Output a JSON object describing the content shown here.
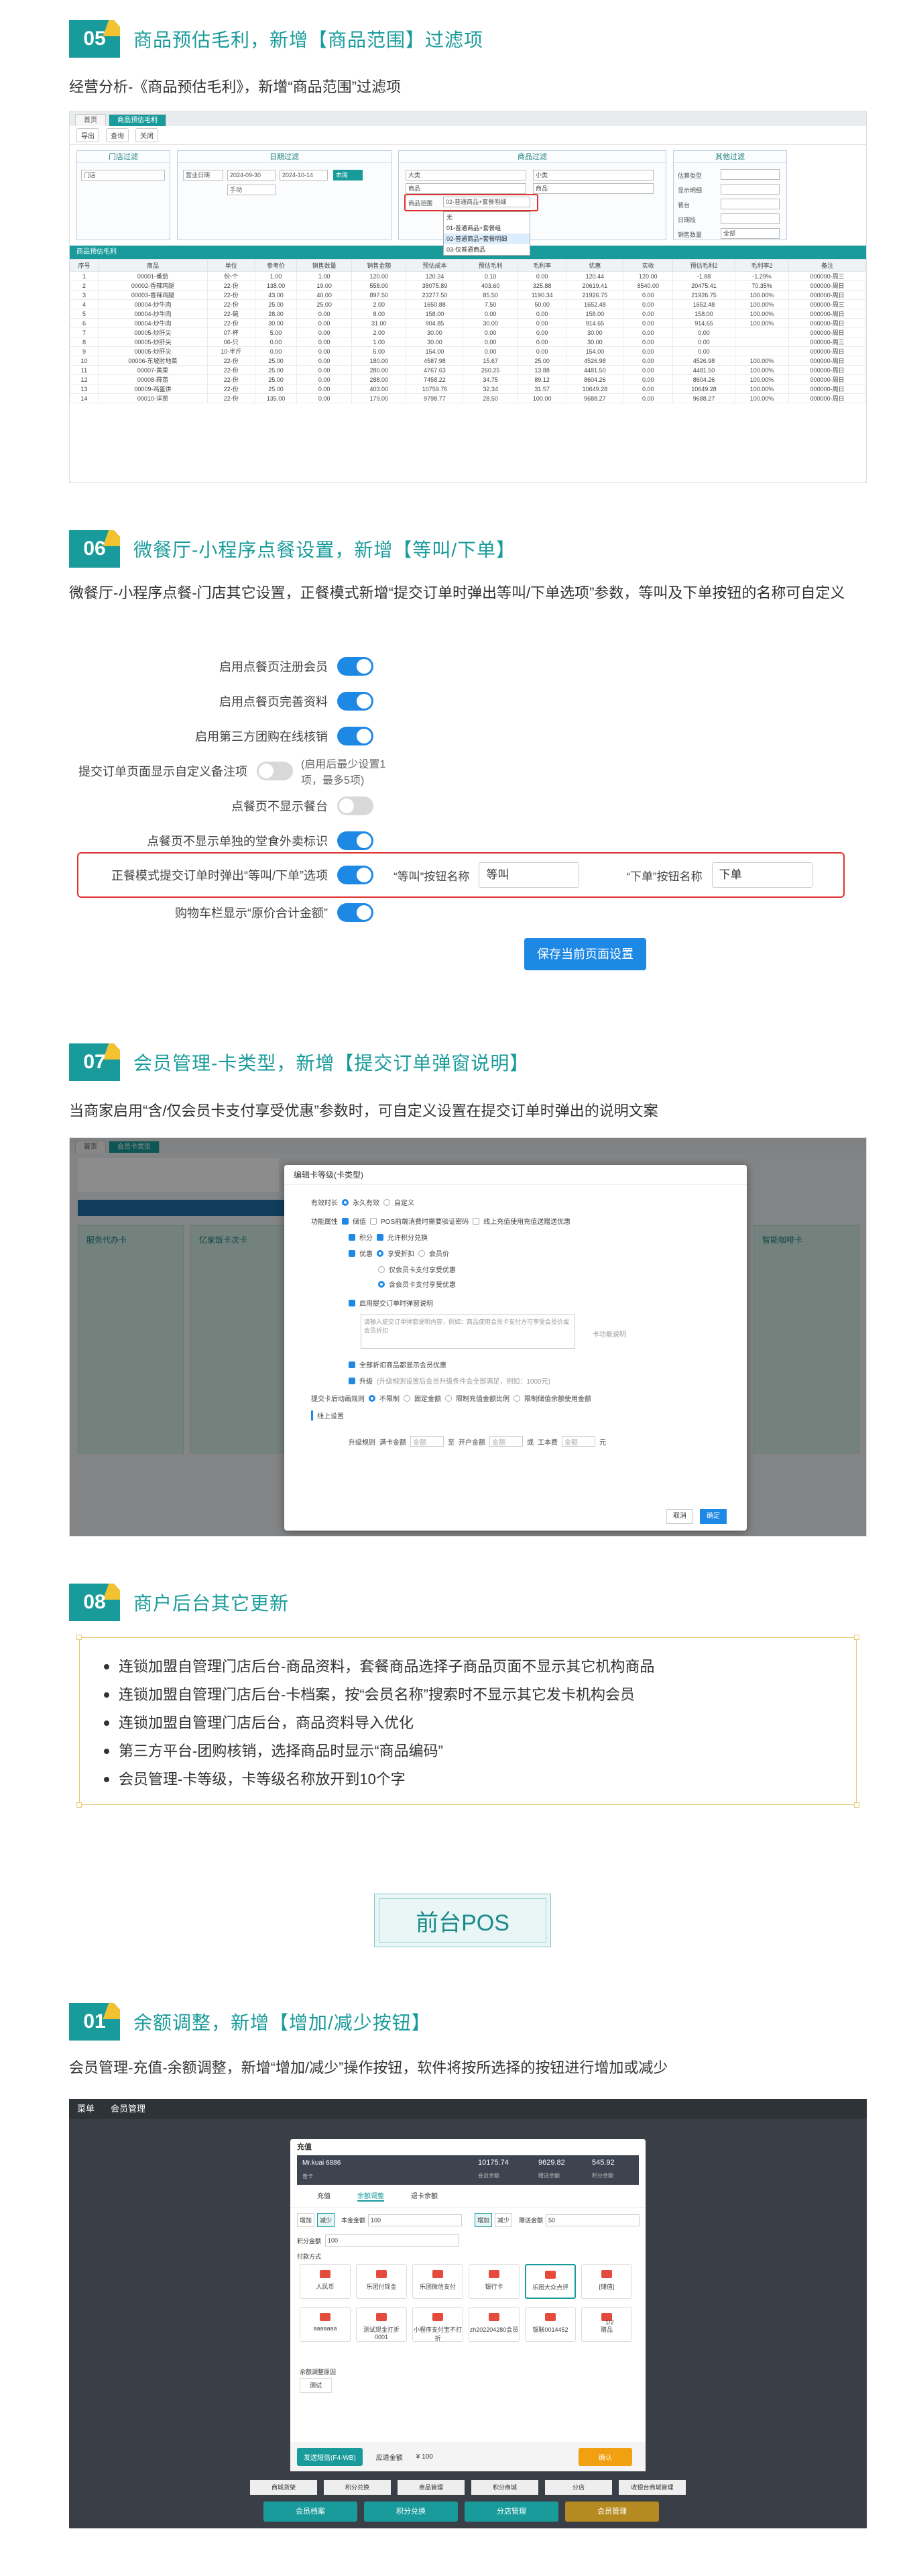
{
  "s05": {
    "num": "05",
    "title": "商品预估毛利，新增【商品范围】过滤项",
    "desc": "经营分析-《商品预估毛利》，新增“商品范围”过滤项",
    "tabs": [
      "首页",
      "商品预估毛利"
    ],
    "toolbar": [
      "导出",
      "查询",
      "关闭"
    ],
    "filter_titles": [
      "门店过滤",
      "日期过滤",
      "商品过滤",
      "其他过滤"
    ],
    "store_label": "门店",
    "date_type": "营业日期",
    "date_from": "2024-09-30",
    "date_to": "2024-10-14",
    "date_btn": "本周",
    "period": "手动",
    "goods_type": "大类",
    "goods_sub": "小类",
    "goods_name": "商品",
    "goods_name2": "商品",
    "range_label": "商品范围",
    "range_value": "02-普通商品+套餐明细",
    "range_options": [
      "无",
      "01-普通商品+套餐组",
      "02-普通商品+套餐明细",
      "03-仅普通商品"
    ],
    "other_labels": [
      "估算类型",
      "显示明细",
      "餐台",
      "日期段",
      "销售数量"
    ],
    "other_value": "全部",
    "table_title": "商品预估毛利",
    "columns": [
      "序号",
      "商品",
      "单位",
      "参考价",
      "销售数量",
      "销售金额",
      "预估成本",
      "预估毛利",
      "毛利率",
      "优惠",
      "实收",
      "预估毛利2",
      "毛利率2",
      "备注"
    ],
    "rows": [
      [
        "1",
        "00001-番茄",
        "份-个",
        "1.00",
        "1.00",
        "120.00",
        "120.24",
        "0.10",
        "0.00",
        "120.44",
        "120.00",
        "-1.88",
        "-1.29%",
        "000000-周三",
        ""
      ],
      [
        "2",
        "00002-香辣鸡腿",
        "22-份",
        "138.00",
        "19.00",
        "558.00",
        "38075.89",
        "403.60",
        "325.88",
        "20619.41",
        "8540.00",
        "20475.41",
        "70.35%",
        "000000-周日",
        "成本"
      ],
      [
        "3",
        "00003-香辣鸡腿",
        "22-份",
        "43.00",
        "40.00",
        "897.50",
        "23277.50",
        "85.50",
        "1190.34",
        "21926.75",
        "0.00",
        "21926.75",
        "100.00%",
        "000000-周日",
        "海鲜珍"
      ],
      [
        "4",
        "00004-炒牛肉",
        "22-份",
        "25.00",
        "25.00",
        "2.00",
        "1650.88",
        "7.50",
        "50.00",
        "1652.48",
        "0.00",
        "1652.48",
        "100.00%",
        "000000-周三",
        ""
      ],
      [
        "5",
        "00004-炒牛肉",
        "22-碗",
        "28.00",
        "0.00",
        "8.00",
        "158.00",
        "0.00",
        "0.00",
        "158.00",
        "0.00",
        "158.00",
        "100.00%",
        "000000-周日",
        ""
      ],
      [
        "6",
        "00004-炒牛肉",
        "22-份",
        "30.00",
        "0.00",
        "31.00",
        "904.85",
        "30.00",
        "0.00",
        "914.65",
        "0.00",
        "914.65",
        "100.00%",
        "000000-周日",
        ""
      ],
      [
        "7",
        "00005-炒肝尖",
        "07-杯",
        "5.00",
        "0.00",
        "2.00",
        "30.00",
        "0.00",
        "0.00",
        "30.00",
        "0.00",
        "0.00",
        "",
        "000000-周日",
        ""
      ],
      [
        "8",
        "00005-炒肝尖",
        "06-只",
        "0.00",
        "0.00",
        "1.00",
        "30.00",
        "0.00",
        "0.00",
        "30.00",
        "0.00",
        "0.00",
        "",
        "000000-周三",
        ""
      ],
      [
        "9",
        "00005-炒肝尖",
        "10-半斤",
        "0.00",
        "0.00",
        "5.00",
        "154.00",
        "0.00",
        "0.00",
        "154.00",
        "0.00",
        "0.00",
        "",
        "000000-周日",
        ""
      ],
      [
        "10",
        "00006-东坡肘地菜",
        "22-份",
        "25.00",
        "0.00",
        "180.00",
        "4587.98",
        "15.67",
        "25.00",
        "4526.98",
        "0.00",
        "4526.98",
        "100.00%",
        "000000-周日",
        ""
      ],
      [
        "11",
        "00007-黄菜",
        "22-份",
        "25.00",
        "0.00",
        "280.00",
        "4767.63",
        "260.25",
        "13.88",
        "4481.50",
        "0.00",
        "4481.50",
        "100.00%",
        "000000-周日",
        ""
      ],
      [
        "12",
        "00008-蒜苗",
        "22-份",
        "25.00",
        "0.00",
        "288.00",
        "7458.22",
        "34.75",
        "89.12",
        "8604.26",
        "0.00",
        "8604.26",
        "100.00%",
        "000000-周日",
        ""
      ],
      [
        "13",
        "00009-鸡蛋饼",
        "22-份",
        "25.00",
        "0.00",
        "403.00",
        "10759.76",
        "32.34",
        "31.57",
        "10649.28",
        "0.00",
        "10649.28",
        "100.00%",
        "000000-周日",
        ""
      ],
      [
        "14",
        "00010-洋葱",
        "22-份",
        "135.00",
        "0.00",
        "179.00",
        "9798.77",
        "28.50",
        "100.00",
        "9688.27",
        "0.00",
        "9688.27",
        "100.00%",
        "000000-周日",
        ""
      ]
    ]
  },
  "s06": {
    "num": "06",
    "title": "微餐厅-小程序点餐设置，新增【等叫/下单】",
    "desc": "微餐厅-小程序点餐-门店其它设置，正餐模式新增“提交订单时弹出等叫/下单选项”参数，等叫及下单按钮的名称可自定义",
    "settings": [
      {
        "label": "启用点餐页注册会员",
        "on": true,
        "hint": ""
      },
      {
        "label": "启用点餐页完善资料",
        "on": true,
        "hint": ""
      },
      {
        "label": "启用第三方团购在线核销",
        "on": true,
        "hint": ""
      },
      {
        "label": "提交订单页面显示自定义备注项",
        "on": false,
        "hint": "(启用后最少设置1项，最多5项)"
      },
      {
        "label": "点餐页不显示餐台",
        "on": false,
        "hint": ""
      },
      {
        "label": "点餐页不显示单独的堂食外卖标识",
        "on": true,
        "hint": ""
      }
    ],
    "highlight_label": "正餐模式提交订单时弹出“等叫/下单”选项",
    "wait_label": "“等叫”按钮名称",
    "wait_value": "等叫",
    "order_label": "“下单”按钮名称",
    "order_value": "下单",
    "cart_label": "购物车栏显示“原价合计金额”",
    "save_label": "保存当前页面设置"
  },
  "s07": {
    "num": "07",
    "title": "会员管理-卡类型，新增【提交订单弹窗说明】",
    "desc": "当商家启用“含/仅会员卡支付享受优惠”参数时，可自定义设置在提交订单时弹出的说明文案",
    "tabs": [
      "首页",
      "会员卡类型"
    ],
    "modal_title": "编辑卡等级(卡类型)",
    "valid_label": "有效时长",
    "valid_options": [
      "永久有效",
      "自定义"
    ],
    "func_label": "功能属性",
    "func_items": [
      "储值",
      "POS前端消费时需要验证密码",
      "线上充值使用充值送赠送优惠"
    ],
    "points": "积分",
    "points_sub": "允许积分兑换",
    "discount": "优惠",
    "discount_options": [
      "享受折扣",
      "会员价"
    ],
    "discount_sub1": "仅会员卡支付享受优惠",
    "discount_sub2": "含会员卡支付享受优惠",
    "popup_label": "启用提交订单时弹窗说明",
    "popup_placeholder": "请输入提交订单弹窗说明内容，例如：商品使用会员卡支付方可享受会员价或会员折扣",
    "popup_side": "卡功能说明",
    "show_all": "全部折扣商品都显示会员优惠",
    "upgrade": "升级",
    "upgrade_hint": "(升级规则设置后会员升级条件会全部满足，例如：1000元)",
    "recharge_label": "提交卡后动画规则",
    "recharge_options": [
      "不限制",
      "固定金额",
      "限制充值金额比例",
      "限制储值余额使用金额"
    ],
    "online_label": "线上设置",
    "upgrade_row": [
      "升级规则",
      "满卡金额",
      "金额",
      "至",
      "开户金额",
      "金额",
      "或",
      "工本费",
      "金额",
      "元"
    ],
    "cancel": "取消",
    "confirm": "确定",
    "cards": [
      "服务代办卡",
      "亿家饭卡次卡",
      "",
      "",
      "",
      "",
      "智能咖啡卡"
    ]
  },
  "s08": {
    "num": "08",
    "title": "商户后台其它更新",
    "items": [
      "连锁加盟自管理门店后台-商品资料，套餐商品选择子商品页面不显示其它机构商品",
      "连锁加盟自管理门店后台-卡档案，按“会员名称”搜索时不显示其它发卡机构会员",
      "连锁加盟自管理门店后台，商品资料导入优化",
      "第三方平台-团购核销，选择商品时显示“商品编码”",
      "会员管理-卡等级，卡等级名称放开到10个字"
    ]
  },
  "pos": {
    "banner": "前台POS",
    "num": "01",
    "title": "余额调整，新增【增加/减少按钮】",
    "desc": "会员管理-充值-余额调整，新增“增加/减少”操作按钮，软件将按所选择的按钮进行增加或减少",
    "top_menu": [
      "菜单",
      "会员管理"
    ],
    "modal_title": "充值",
    "member_name": "Mr.kuai 6886",
    "member_sub": "普卡",
    "balance1": "10175.74",
    "balance1_label": "会员余额",
    "balance2": "9629.82",
    "balance2_label": "赠送余额",
    "balance3": "545.92",
    "balance3_label": "积分余额",
    "tabs": [
      "充值",
      "余额调整",
      "退卡余额"
    ],
    "add": "增加",
    "minus": "减少",
    "main_label": "本金金额",
    "main_value": "100",
    "gift_label": "赠送金额",
    "gift_value": "50",
    "points_label": "积分金额",
    "points_value": "100",
    "pay_label": "付款方式",
    "pay_methods": [
      "人民币",
      "乐团付现金",
      "乐团微信支付",
      "银行卡",
      "乐团大众点评",
      "[储值]",
      "aaaaaaa",
      "测试现金打折0001",
      "小程序支付宝不打折",
      "zh202204280会员",
      "银联0014452",
      "赠品"
    ],
    "pager": "1/2",
    "note_label": "余额调整原因",
    "note_value": "测试",
    "sms_btn": "发送短信(F4-WB)",
    "total_label": "应退金额",
    "total_value": "¥ 100",
    "confirm": "确认",
    "bottom": [
      "商城货架",
      "积分兑换",
      "商品管理",
      "积分商城",
      "分店",
      "收银台商城管理"
    ],
    "footer_btns": [
      "会员档案",
      "积分兑换",
      "分店管理",
      "会员管理"
    ]
  }
}
